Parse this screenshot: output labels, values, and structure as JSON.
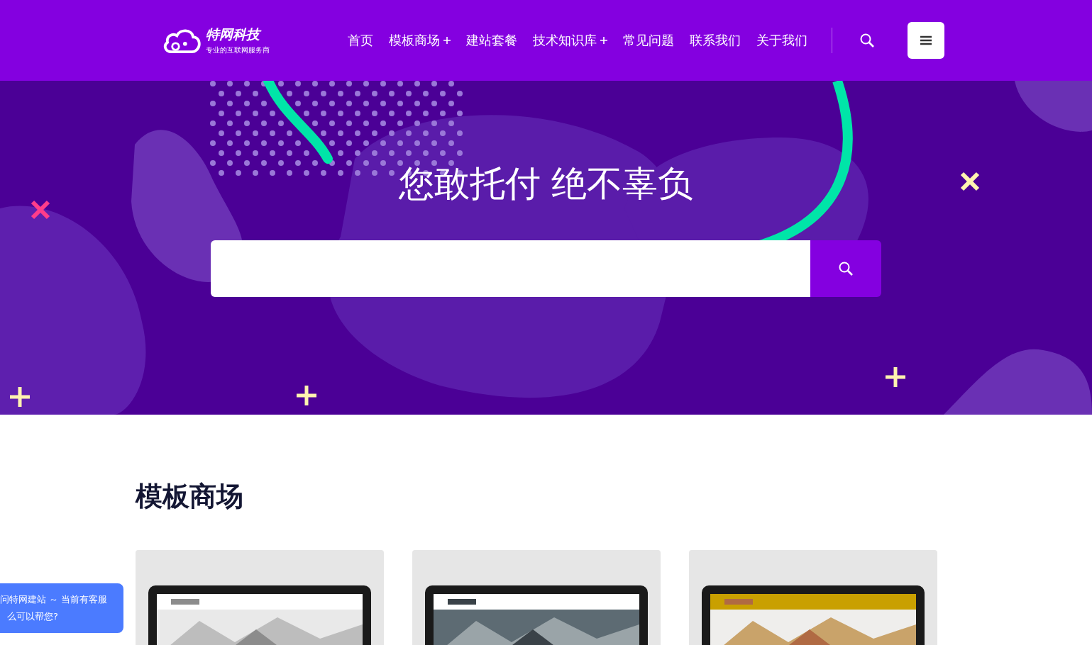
{
  "header": {
    "logo": {
      "name": "特网科技",
      "tagline": "专业的互联网服务商"
    },
    "nav": [
      {
        "label": "首页",
        "has_submenu": false
      },
      {
        "label": "模板商场",
        "has_submenu": true
      },
      {
        "label": "建站套餐",
        "has_submenu": false
      },
      {
        "label": "技术知识库",
        "has_submenu": true
      },
      {
        "label": "常见问题",
        "has_submenu": false
      },
      {
        "label": "联系我们",
        "has_submenu": false
      },
      {
        "label": "关于我们",
        "has_submenu": false
      }
    ]
  },
  "hero": {
    "title": "您敢托付 绝不辜负"
  },
  "section": {
    "title": "模板商场"
  },
  "chat": {
    "lines": [
      "问特网建站 ～ 当前有客服",
      "么可以帮您?"
    ]
  }
}
